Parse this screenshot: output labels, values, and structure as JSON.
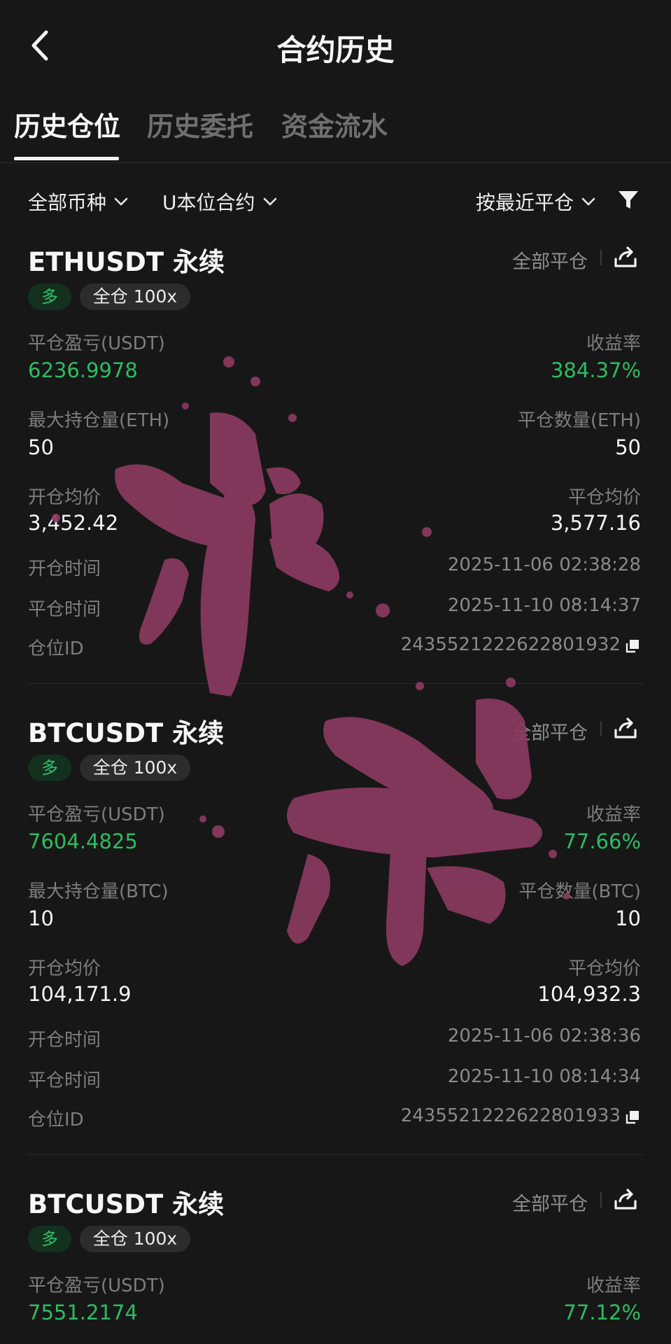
{
  "header": {
    "title": "合约历史"
  },
  "tabs": [
    {
      "label": "历史仓位",
      "active": true
    },
    {
      "label": "历史委托",
      "active": false
    },
    {
      "label": "资金流水",
      "active": false
    }
  ],
  "filters": {
    "coin": "全部币种",
    "contract": "U本位合约",
    "sort": "按最近平仓"
  },
  "labels": {
    "pnl": "平仓盈亏(USDT)",
    "roi": "收益率",
    "open_avg": "开仓均价",
    "close_avg": "平仓均价",
    "open_time": "开仓时间",
    "close_time": "平仓时间",
    "position_id": "仓位ID",
    "close_all": "全部平仓"
  },
  "positions": [
    {
      "symbol": "ETHUSDT 永续",
      "direction": "多",
      "mode": "全仓 100x",
      "pnl": "6236.9978",
      "roi": "384.37%",
      "max_hold_label": "最大持仓量(ETH)",
      "max_hold": "50",
      "close_qty_label": "平仓数量(ETH)",
      "close_qty": "50",
      "open_avg": "3,452.42",
      "close_avg": "3,577.16",
      "open_time": "2025-11-06 02:38:28",
      "close_time": "2025-11-10 08:14:37",
      "position_id": "2435521222622801932"
    },
    {
      "symbol": "BTCUSDT 永续",
      "direction": "多",
      "mode": "全仓 100x",
      "pnl": "7604.4825",
      "roi": "77.66%",
      "max_hold_label": "最大持仓量(BTC)",
      "max_hold": "10",
      "close_qty_label": "平仓数量(BTC)",
      "close_qty": "10",
      "open_avg": "104,171.9",
      "close_avg": "104,932.3",
      "open_time": "2025-11-06 02:38:36",
      "close_time": "2025-11-10 08:14:34",
      "position_id": "2435521222622801933"
    },
    {
      "symbol": "BTCUSDT 永续",
      "direction": "多",
      "mode": "全仓 100x",
      "pnl": "7551.2174",
      "roi": "77.12%"
    }
  ],
  "colors": {
    "background": "#171717",
    "profit_green": "#2bbd62",
    "long_badge": "#2fc46a",
    "stamp": "#8a3a5e"
  },
  "icons": [
    "back-arrow-icon",
    "chevron-down-icon",
    "filter-funnel-icon",
    "share-icon",
    "copy-icon"
  ]
}
